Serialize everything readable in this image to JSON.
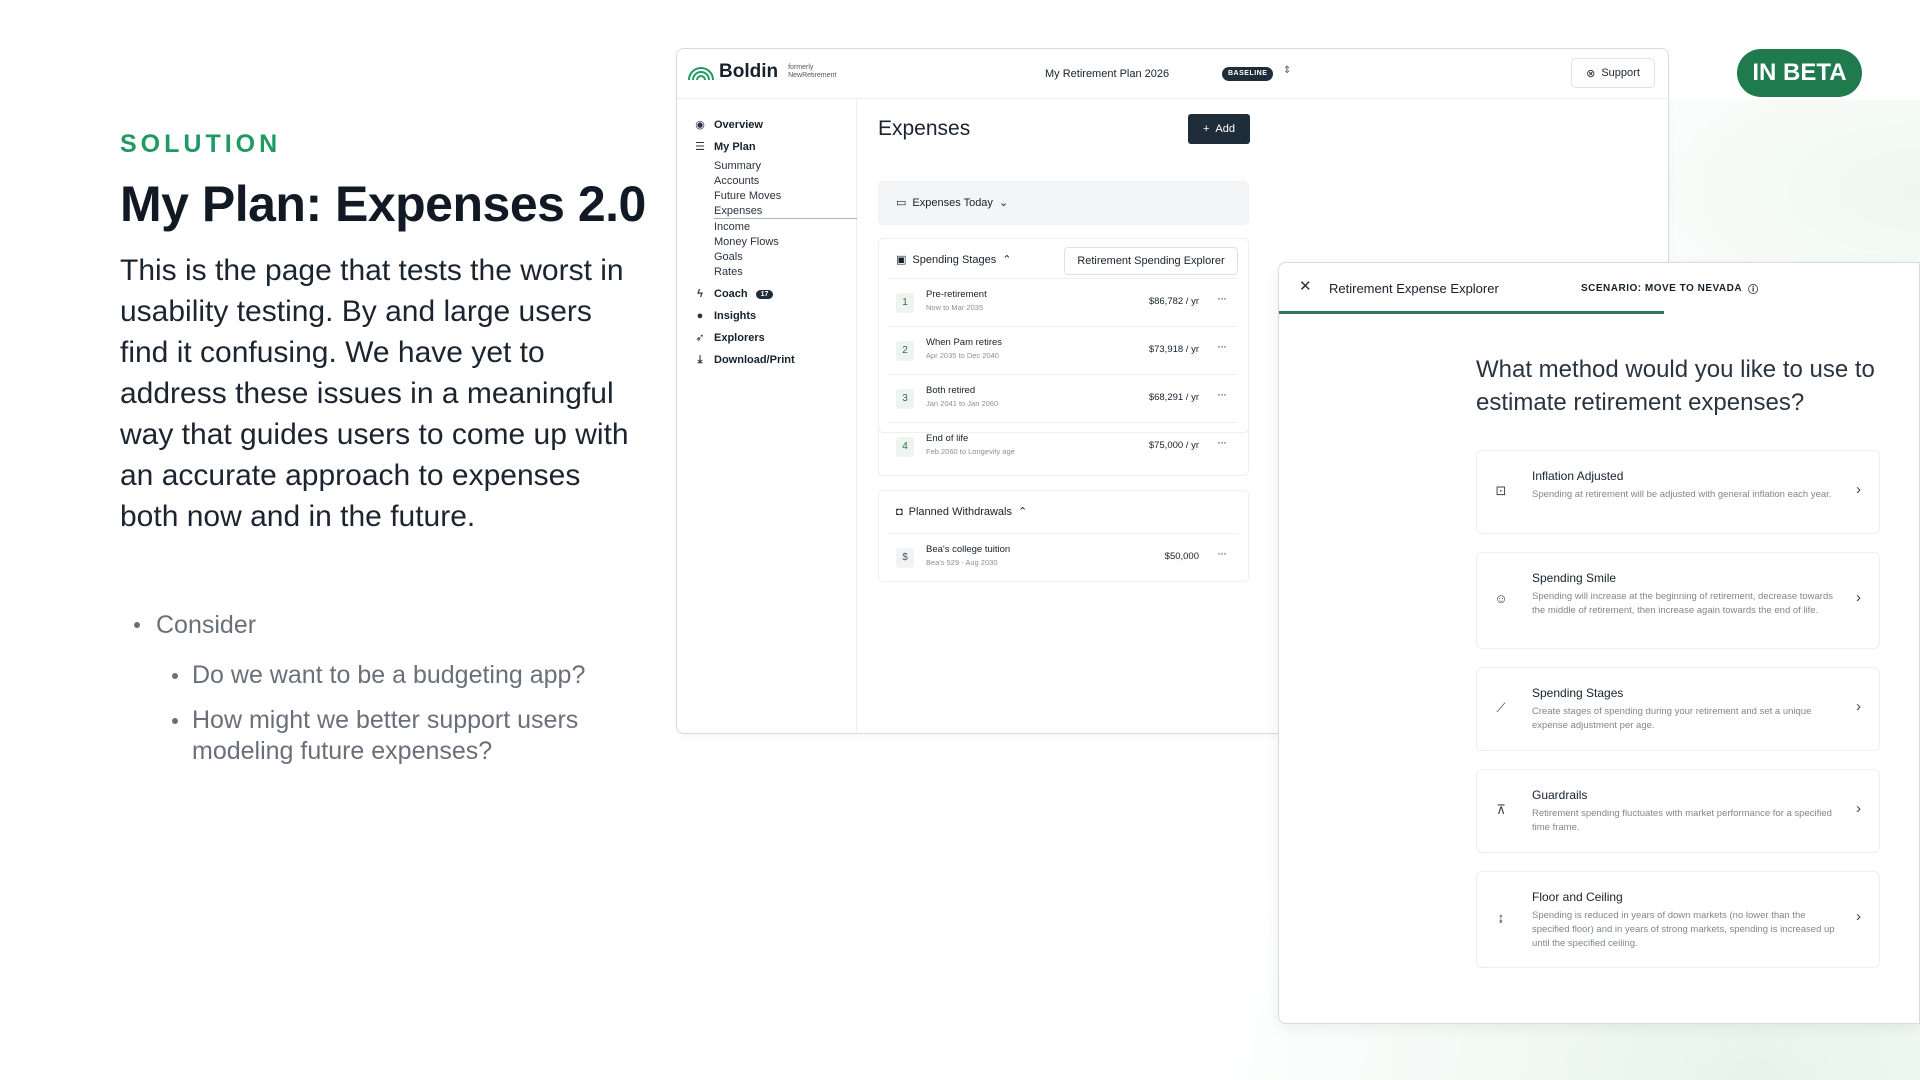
{
  "slide": {
    "eyebrow": "SOLUTION",
    "headline": "My Plan: Expenses 2.0",
    "body": "This is the page that tests the worst in usability testing. By and large users find it confusing. We have yet to address these issues in a meaningful way that guides users to come up with an accurate approach to expenses both now and in the future.",
    "bullet": "Consider",
    "sub_bullets": [
      "Do we want to be a budgeting app?",
      "How might we better support users modeling future expenses?"
    ],
    "beta_badge": "IN BETA"
  },
  "app": {
    "brand": "Boldin",
    "formerly_line1": "formerly",
    "formerly_line2": "NewRetirement",
    "plan_name": "My Retirement Plan 2026",
    "plan_badge": "BASELINE",
    "support_label": "Support",
    "sidebar": {
      "overview": "Overview",
      "my_plan": "My Plan",
      "sub_items": [
        "Summary",
        "Accounts",
        "Future Moves",
        "Expenses",
        "Income",
        "Money Flows",
        "Goals",
        "Rates"
      ],
      "coach": "Coach",
      "coach_count": "17",
      "insights": "Insights",
      "explorers": "Explorers",
      "download": "Download/Print"
    },
    "main": {
      "title": "Expenses",
      "add_label": "Add",
      "expenses_today": "Expenses Today",
      "spending_stages": "Spending Stages",
      "rse_button": "Retirement Spending Explorer",
      "stages": [
        {
          "num": "1",
          "title": "Pre-retirement",
          "sub": "Now to Mar 2035",
          "amount": "$86,782 / yr"
        },
        {
          "num": "2",
          "title": "When Pam retires",
          "sub": "Apr 2035 to Dec 2040",
          "amount": "$73,918 / yr"
        },
        {
          "num": "3",
          "title": "Both retired",
          "sub": "Jan 2041 to Jan 2060",
          "amount": "$68,291 / yr"
        },
        {
          "num": "4",
          "title": "End of life",
          "sub": "Feb 2060 to Longevity age",
          "amount": "$75,000 / yr"
        }
      ],
      "planned_withdrawals": "Planned Withdrawals",
      "withdrawal": {
        "title": "Bea's college tuition",
        "sub": "Bea's 529 - Aug 2030",
        "amount": "$50,000"
      }
    }
  },
  "explorer": {
    "title": "Retirement Expense Explorer",
    "scenario": "SCENARIO: MOVE TO NEVADA",
    "progress": 0.6,
    "question": "What method would you like to use to estimate retirement expenses?",
    "options": [
      {
        "title": "Inflation Adjusted",
        "desc": "Spending at retirement will be adjusted with general inflation each year."
      },
      {
        "title": "Spending Smile",
        "desc": "Spending will increase at the beginning of retirement, decrease towards the middle of retirement, then increase again towards the end of life."
      },
      {
        "title": "Spending Stages",
        "desc": "Create stages of spending during your retirement and set a unique expense adjustment per age."
      },
      {
        "title": "Guardrails",
        "desc": "Retirement spending fluctuates with market performance for a specified time frame."
      },
      {
        "title": "Floor and Ceiling",
        "desc": "Spending is reduced in years of down markets (no lower than the specified floor) and in years of strong markets, spending is increased up until the specified ceiling."
      }
    ]
  },
  "colors": {
    "accent_green": "#1f9a63",
    "badge_green": "#1f7a4e",
    "dark_button": "#1f2c3a"
  }
}
